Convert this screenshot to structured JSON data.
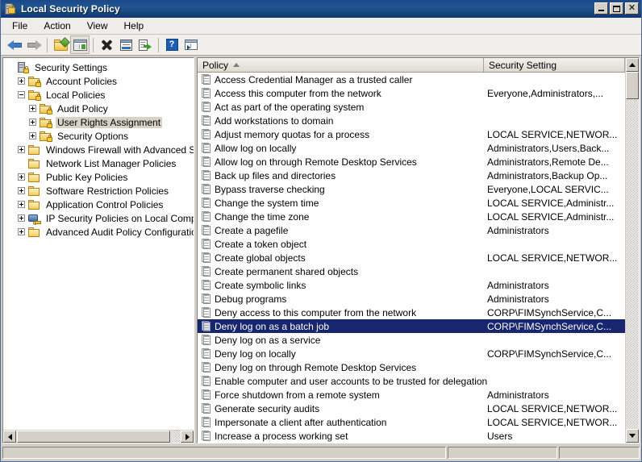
{
  "window": {
    "title": "Local Security Policy",
    "title_icon": "security-policy-icon",
    "buttons": {
      "minimize": "minimize-button",
      "maximize": "maximize-button",
      "close": "close-button",
      "close_glyph": "✕"
    }
  },
  "menubar": {
    "items": [
      {
        "label": "File"
      },
      {
        "label": "Action"
      },
      {
        "label": "View"
      },
      {
        "label": "Help"
      }
    ]
  },
  "toolbar": {
    "buttons": [
      {
        "name": "back-button",
        "icon": "back-arrow-icon"
      },
      {
        "name": "forward-button",
        "icon": "forward-arrow-icon"
      },
      {
        "name": "up-one-level-button",
        "icon": "folder-up-icon"
      },
      {
        "name": "show-hide-console-tree-button",
        "icon": "console-tree-icon",
        "pressed": true
      },
      {
        "name": "delete-button",
        "icon": "delete-x-icon"
      },
      {
        "name": "properties-button",
        "icon": "properties-icon"
      },
      {
        "name": "export-list-button",
        "icon": "export-list-icon"
      },
      {
        "name": "help-button",
        "icon": "help-question-icon",
        "glyph": "?"
      },
      {
        "name": "show-action-pane-button",
        "icon": "action-pane-icon"
      }
    ]
  },
  "tree": {
    "nodes": [
      {
        "label": "Security Settings",
        "indent": 0,
        "expander": "none",
        "icon": "security-settings-icon",
        "selected": false
      },
      {
        "label": "Account Policies",
        "indent": 1,
        "expander": "plus",
        "icon": "policy-folder-icon",
        "selected": false
      },
      {
        "label": "Local Policies",
        "indent": 1,
        "expander": "minus",
        "icon": "policy-folder-icon",
        "selected": false
      },
      {
        "label": "Audit Policy",
        "indent": 2,
        "expander": "plus",
        "icon": "policy-folder-icon",
        "selected": false
      },
      {
        "label": "User Rights Assignment",
        "indent": 2,
        "expander": "plus",
        "icon": "policy-folder-icon",
        "selected": true
      },
      {
        "label": "Security Options",
        "indent": 2,
        "expander": "plus",
        "icon": "policy-folder-icon",
        "selected": false
      },
      {
        "label": "Windows Firewall with Advanced Security",
        "indent": 1,
        "expander": "plus",
        "icon": "folder-icon",
        "selected": false
      },
      {
        "label": "Network List Manager Policies",
        "indent": 1,
        "expander": "none",
        "icon": "folder-icon",
        "selected": false
      },
      {
        "label": "Public Key Policies",
        "indent": 1,
        "expander": "plus",
        "icon": "folder-icon",
        "selected": false
      },
      {
        "label": "Software Restriction Policies",
        "indent": 1,
        "expander": "plus",
        "icon": "folder-icon",
        "selected": false
      },
      {
        "label": "Application Control Policies",
        "indent": 1,
        "expander": "plus",
        "icon": "folder-icon",
        "selected": false
      },
      {
        "label": "IP Security Policies on Local Computer",
        "indent": 1,
        "expander": "plus",
        "icon": "ip-security-icon",
        "selected": false
      },
      {
        "label": "Advanced Audit Policy Configuration",
        "indent": 1,
        "expander": "plus",
        "icon": "folder-icon",
        "selected": false
      }
    ]
  },
  "list": {
    "columns": [
      {
        "label": "Policy",
        "sorted": true,
        "sort_direction": "asc"
      },
      {
        "label": "Security Setting",
        "sorted": false,
        "sort_direction": ""
      }
    ],
    "rows": [
      {
        "policy": "Access Credential Manager as a trusted caller",
        "setting": "",
        "selected": false
      },
      {
        "policy": "Access this computer from the network",
        "setting": "Everyone,Administrators,...",
        "selected": false
      },
      {
        "policy": "Act as part of the operating system",
        "setting": "",
        "selected": false
      },
      {
        "policy": "Add workstations to domain",
        "setting": "",
        "selected": false
      },
      {
        "policy": "Adjust memory quotas for a process",
        "setting": "LOCAL SERVICE,NETWOR...",
        "selected": false
      },
      {
        "policy": "Allow log on locally",
        "setting": "Administrators,Users,Back...",
        "selected": false
      },
      {
        "policy": "Allow log on through Remote Desktop Services",
        "setting": "Administrators,Remote De...",
        "selected": false
      },
      {
        "policy": "Back up files and directories",
        "setting": "Administrators,Backup Op...",
        "selected": false
      },
      {
        "policy": "Bypass traverse checking",
        "setting": "Everyone,LOCAL SERVIC...",
        "selected": false
      },
      {
        "policy": "Change the system time",
        "setting": "LOCAL SERVICE,Administr...",
        "selected": false
      },
      {
        "policy": "Change the time zone",
        "setting": "LOCAL SERVICE,Administr...",
        "selected": false
      },
      {
        "policy": "Create a pagefile",
        "setting": "Administrators",
        "selected": false
      },
      {
        "policy": "Create a token object",
        "setting": "",
        "selected": false
      },
      {
        "policy": "Create global objects",
        "setting": "LOCAL SERVICE,NETWOR...",
        "selected": false
      },
      {
        "policy": "Create permanent shared objects",
        "setting": "",
        "selected": false
      },
      {
        "policy": "Create symbolic links",
        "setting": "Administrators",
        "selected": false
      },
      {
        "policy": "Debug programs",
        "setting": "Administrators",
        "selected": false
      },
      {
        "policy": "Deny access to this computer from the network",
        "setting": "CORP\\FIMSynchService,C...",
        "selected": false
      },
      {
        "policy": "Deny log on as a batch job",
        "setting": "CORP\\FIMSynchService,C...",
        "selected": true
      },
      {
        "policy": "Deny log on as a service",
        "setting": "",
        "selected": false
      },
      {
        "policy": "Deny log on locally",
        "setting": "CORP\\FIMSynchService,C...",
        "selected": false
      },
      {
        "policy": "Deny log on through Remote Desktop Services",
        "setting": "",
        "selected": false
      },
      {
        "policy": "Enable computer and user accounts to be trusted for delegation",
        "setting": "",
        "selected": false
      },
      {
        "policy": "Force shutdown from a remote system",
        "setting": "Administrators",
        "selected": false
      },
      {
        "policy": "Generate security audits",
        "setting": "LOCAL SERVICE,NETWOR...",
        "selected": false
      },
      {
        "policy": "Impersonate a client after authentication",
        "setting": "LOCAL SERVICE,NETWOR...",
        "selected": false
      },
      {
        "policy": "Increase a process working set",
        "setting": "Users",
        "selected": false
      }
    ]
  },
  "statusbar": {
    "panel_main": "",
    "panel_two": "",
    "panel_three": ""
  },
  "colors": {
    "title_gradient_start": "#1b4888",
    "title_gradient_end": "#10386f",
    "selection": "#17266e",
    "tree_selection": "#d7d3c9",
    "window_face": "#d4d0c8"
  }
}
